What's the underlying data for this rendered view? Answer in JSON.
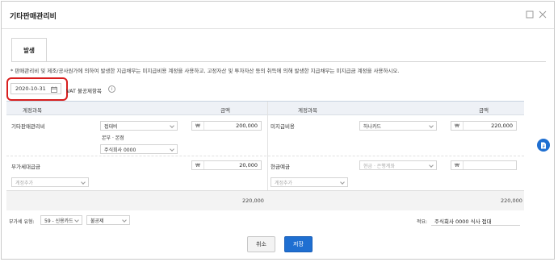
{
  "dialog": {
    "title": "기타판매관리비"
  },
  "tabs": [
    {
      "label": "발생",
      "active": true
    }
  ],
  "notice": "* 판매관리비 및 제조/공사원가에 의하여 발생한 지급채무는 미지급비용 계정을 사용하고, 고정자산 및 투자자산 등의 취득에 의해 발생한 지급채무는 미지급금 계정을 사용하시오.",
  "date": "2020-10-31",
  "vat_label": "VAT 불공제항목",
  "table": {
    "headers": {
      "left_account": "계정과목",
      "left_amount": "금액",
      "right_account": "계정과목",
      "right_amount": "금액"
    },
    "currency": "₩",
    "left_rows": [
      {
        "account": "기타판매관리비",
        "sub_select": "접대비",
        "dept_label": "본부 · 본점",
        "dept_select": "주식회사 0000",
        "amount": "200,000"
      },
      {
        "account": "부가세대급금",
        "amount": "20,000"
      }
    ],
    "left_add_placeholder": "계정추가",
    "right_rows": [
      {
        "account": "미지급비용",
        "sub_select": "하나카드",
        "amount": "220,000"
      },
      {
        "account": "현금예금",
        "sub_select_placeholder": "현금 · 은행계좌",
        "amount": ""
      }
    ],
    "right_add_placeholder": "계정추가",
    "left_total": "220,000",
    "right_total": "220,000"
  },
  "footer": {
    "vat_type_label": "부가세 유형:",
    "vat_type_value": "59 - 신용카드",
    "deduct_value": "불공제",
    "memo_label": "적요:",
    "memo_value": "주식회사 0000 식사 접대"
  },
  "buttons": {
    "cancel": "취소",
    "save": "저장"
  },
  "colors": {
    "primary": "#1f6fd1",
    "highlight": "#d81e1e",
    "header_bg": "#eef1f6"
  }
}
